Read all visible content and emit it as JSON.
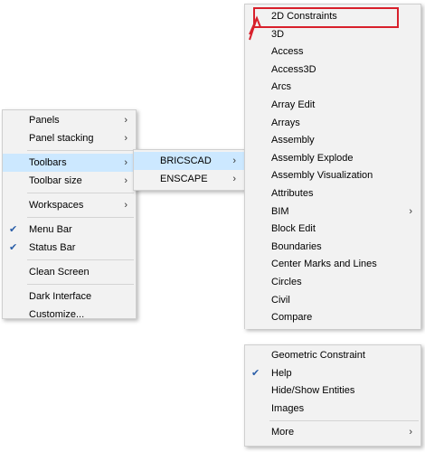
{
  "main_menu": {
    "items": [
      {
        "label": "Panels",
        "submenu": true
      },
      {
        "label": "Panel stacking",
        "submenu": true
      },
      {
        "label": "Toolbars",
        "submenu": true
      },
      {
        "label": "Toolbar size",
        "submenu": true
      },
      {
        "label": "Workspaces",
        "submenu": true
      },
      {
        "label": "Menu Bar",
        "checked": true
      },
      {
        "label": "Status Bar",
        "checked": true
      },
      {
        "label": "Clean Screen"
      },
      {
        "label": "Dark Interface"
      },
      {
        "label": "Customize..."
      }
    ]
  },
  "toolbars_menu": {
    "items": [
      {
        "label": "BRICSCAD",
        "submenu": true
      },
      {
        "label": "ENSCAPE",
        "submenu": true
      }
    ]
  },
  "bricscad_menu": {
    "items": [
      "2D Constraints",
      "3D",
      "Access",
      "Access3D",
      "Arcs",
      "Array Edit",
      "Arrays",
      "Assembly",
      "Assembly Explode",
      "Assembly Visualization",
      "Attributes",
      "BIM",
      "Block Edit",
      "Boundaries",
      "Center Marks and Lines",
      "Circles",
      "Civil",
      "Compare"
    ],
    "bim_has_submenu": true,
    "lower_items": [
      "Geometric Constraint",
      "Help",
      "Hide/Show Entities",
      "Images",
      "More"
    ],
    "help_checked": true,
    "more_has_submenu": true
  },
  "highlight_color": "#cce8ff",
  "annotation_color": "#d8202b"
}
